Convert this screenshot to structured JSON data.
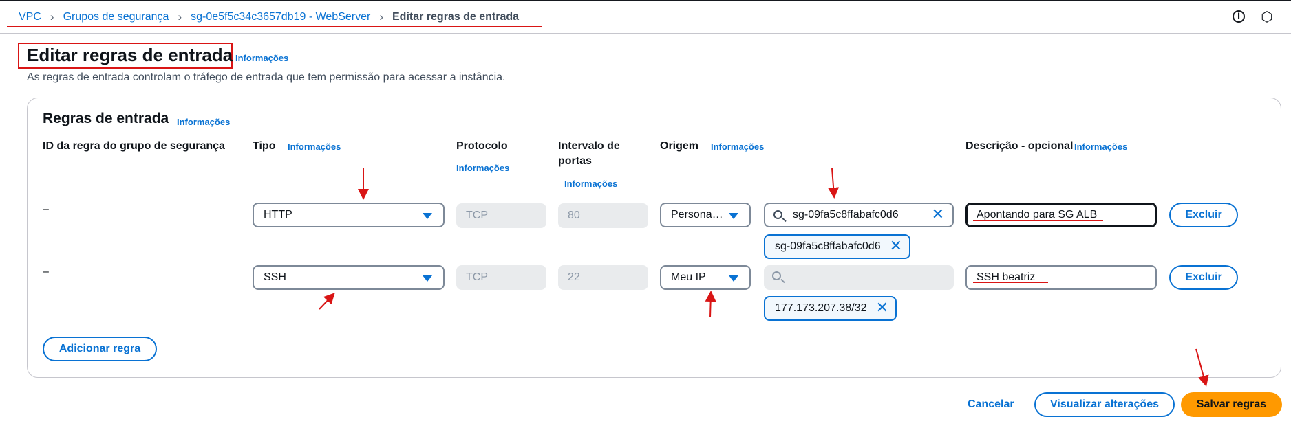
{
  "breadcrumb": {
    "items": [
      "VPC",
      "Grupos de segurança",
      "sg-0e5f5c34c3657db19 - WebServer"
    ],
    "current": "Editar regras de entrada",
    "separator": "›"
  },
  "header_icons": {
    "info": "i",
    "settings": "⬡"
  },
  "page": {
    "title": "Editar regras de entrada",
    "info": "Informações",
    "description": "As regras de entrada controlam o tráfego de entrada que tem permissão para acessar a instância."
  },
  "section": {
    "title": "Regras de entrada",
    "info": "Informações"
  },
  "columns": {
    "rule_id": "ID da regra do grupo de segurança",
    "type": "Tipo",
    "type_info": "Informações",
    "protocol": "Protocolo",
    "protocol_info": "Informações",
    "port_range_1": "Intervalo de",
    "port_range_2": "portas",
    "port_info": "Informações",
    "source": "Origem",
    "source_info": "Informações",
    "description": "Descrição - opcional",
    "description_info": "Informações"
  },
  "rules": [
    {
      "id": "–",
      "type": "HTTP",
      "protocol": "TCP",
      "port": "80",
      "source": "Persona…",
      "search_value": "sg-09fa5c8ffabafc0d6",
      "token": "sg-09fa5c8ffabafc0d6",
      "description": "Apontando para SG ALB",
      "delete": "Excluir"
    },
    {
      "id": "–",
      "type": "SSH",
      "protocol": "TCP",
      "port": "22",
      "source": "Meu IP",
      "search_value": "",
      "token": "177.173.207.38/32",
      "description": "SSH beatriz",
      "delete": "Excluir"
    }
  ],
  "buttons": {
    "add_rule": "Adicionar regra",
    "cancel": "Cancelar",
    "preview": "Visualizar alterações",
    "save": "Salvar regras"
  },
  "colors": {
    "link": "#0972d3",
    "primary": "#ff9900",
    "annotation": "#d91515"
  }
}
